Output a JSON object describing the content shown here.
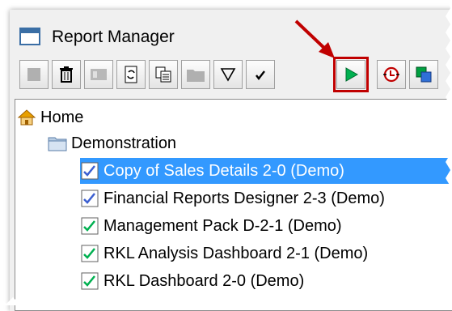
{
  "window": {
    "title": "Report Manager"
  },
  "toolbar": {
    "buttons": [
      {
        "name": "blank-doc-icon",
        "enabled": false
      },
      {
        "name": "delete-icon",
        "enabled": true
      },
      {
        "name": "properties-icon",
        "enabled": false
      },
      {
        "name": "refresh-icon",
        "enabled": true
      },
      {
        "name": "copy-icon",
        "enabled": true
      },
      {
        "name": "folder-icon",
        "enabled": false
      },
      {
        "name": "filter-icon",
        "enabled": true
      },
      {
        "name": "checkmark-icon",
        "enabled": true
      },
      {
        "name": "run-icon",
        "enabled": true,
        "highlighted": true
      },
      {
        "name": "schedule-icon",
        "enabled": true
      },
      {
        "name": "publish-icon",
        "enabled": true
      }
    ]
  },
  "tree": {
    "home": "Home",
    "folder": "Demonstration",
    "items": [
      {
        "label": "Copy of Sales Details 2-0 (Demo)",
        "selected": true,
        "icon": "report-blue-check-icon"
      },
      {
        "label": "Financial Reports Designer 2-3 (Demo)",
        "selected": false,
        "icon": "report-blue-check-icon"
      },
      {
        "label": "Management Pack D-2-1 (Demo)",
        "selected": false,
        "icon": "report-green-check-icon"
      },
      {
        "label": "RKL Analysis Dashboard 2-1 (Demo)",
        "selected": false,
        "icon": "report-green-check-icon"
      },
      {
        "label": "RKL Dashboard 2-0 (Demo)",
        "selected": false,
        "icon": "report-green-check-icon"
      }
    ]
  },
  "colors": {
    "selection": "#3399ff",
    "callout": "#c00000",
    "run": "#00b050"
  }
}
